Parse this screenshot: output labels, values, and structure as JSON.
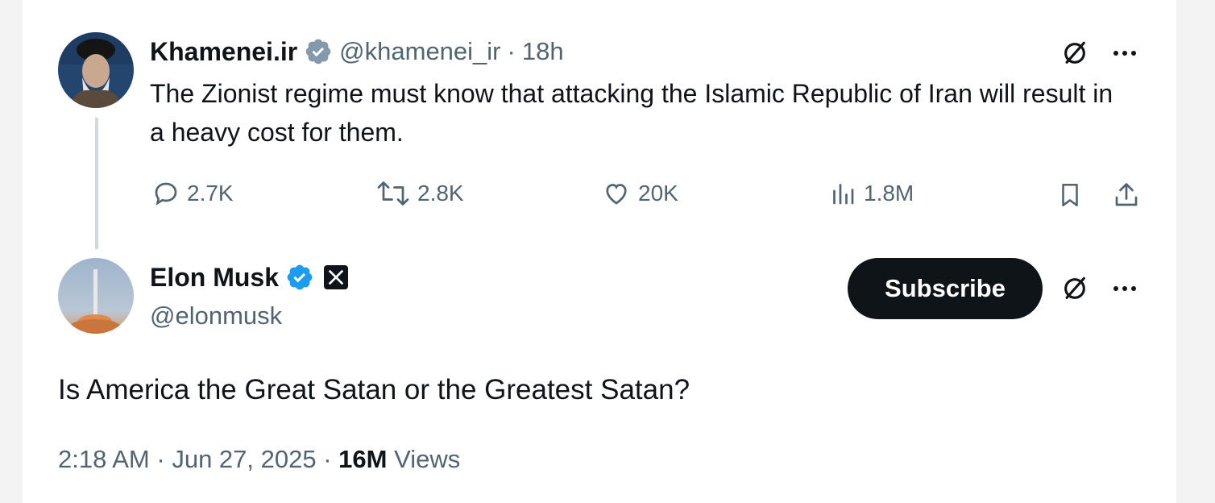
{
  "quoted_tweet": {
    "author_name": "Khamenei.ir",
    "handle": "@khamenei_ir",
    "separator": "·",
    "time": "18h",
    "text": "The Zionist regime must know that attacking the Islamic Republic of Iran will result in a heavy cost for them.",
    "replies": "2.7K",
    "reposts": "2.8K",
    "likes": "20K",
    "views": "1.8M"
  },
  "main_tweet": {
    "author_name": "Elon Musk",
    "handle": "@elonmusk",
    "subscribe_label": "Subscribe",
    "text": "Is America the Great Satan or the Greatest Satan?",
    "time": "2:18 AM",
    "separator": "·",
    "date": "Jun 27, 2025",
    "views_count": "16M",
    "views_label": "Views"
  },
  "icons": {
    "verified": "verified-check-icon",
    "affiliate": "x-logo-icon",
    "grok": "grok-icon",
    "more": "more-icon",
    "reply": "reply-icon",
    "repost": "repost-icon",
    "like": "heart-icon",
    "views": "analytics-icon",
    "bookmark": "bookmark-icon",
    "share": "share-icon"
  },
  "colors": {
    "verified_blue": "#1d9bf0",
    "text_primary": "#0f1419",
    "text_secondary": "#536471",
    "thread_line": "#cfd9de"
  }
}
